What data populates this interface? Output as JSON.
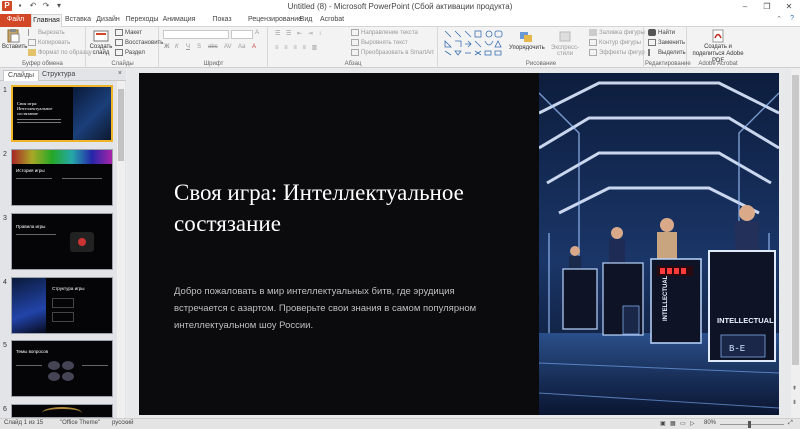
{
  "window": {
    "title": "Untitled (8) - Microsoft PowerPoint (Сбой активации продукта)",
    "app_icon": "P",
    "controls": [
      "–",
      "❐",
      "✕"
    ]
  },
  "tabs": [
    "Файл",
    "Главная",
    "Вставка",
    "Дизайн",
    "Переходы",
    "Анимация",
    "Показ слайдов",
    "Рецензирование",
    "Вид",
    "Acrobat"
  ],
  "ribbon": {
    "clipboard": {
      "paste": "Вставить",
      "cut": "Вырезать",
      "copy": "Копировать",
      "format": "Формат по образцу",
      "label": "Буфер обмена"
    },
    "slides": {
      "new_slide": "Создать слайд",
      "layout": "Макет",
      "reset": "Восстановить",
      "section": "Раздел",
      "label": "Слайды"
    },
    "font": {
      "label": "Шрифт"
    },
    "paragraph": {
      "text_direction": "Направление текста",
      "align_text": "Выровнять текст",
      "smartart": "Преобразовать в SmartArt",
      "label": "Абзац"
    },
    "drawing": {
      "arrange": "Упорядочить",
      "quick_styles": "Экспресс-стили",
      "fill": "Заливка фигуры",
      "outline": "Контур фигуры",
      "effects": "Эффекты фигур",
      "label": "Рисование"
    },
    "editing": {
      "find": "Найти",
      "replace": "Заменить",
      "select": "Выделить",
      "label": "Редактирование"
    },
    "acrobat": {
      "create": "Создать и поделиться Adobe PDF",
      "label": "Adobe Acrobat"
    }
  },
  "panel": {
    "tabs": [
      "Слайды",
      "Структура"
    ],
    "close": "×",
    "thumbs": [
      {
        "num": "1",
        "title": "Своя игра: Интеллектуальное состязание"
      },
      {
        "num": "2",
        "title": "История игры"
      },
      {
        "num": "3",
        "title": "Правила игры"
      },
      {
        "num": "4",
        "title": "Структура игры"
      },
      {
        "num": "5",
        "title": "Темы вопросов"
      },
      {
        "num": "6",
        "title": ""
      }
    ]
  },
  "slide": {
    "title": "Своя игра: Интеллектуальное состязание",
    "subtitle": "Добро пожаловать в мир интеллектуальных битв, где эрудиция встречается с азартом. Проверьте свои знания в самом популярном интеллектуальном шоу России.",
    "podium_text": "INTELLECTUAL",
    "podium_score": "B-E"
  },
  "status": {
    "slide_info": "Слайд 1 из 15",
    "theme": "\"Office Theme\"",
    "language": "русский",
    "zoom": "80%"
  }
}
